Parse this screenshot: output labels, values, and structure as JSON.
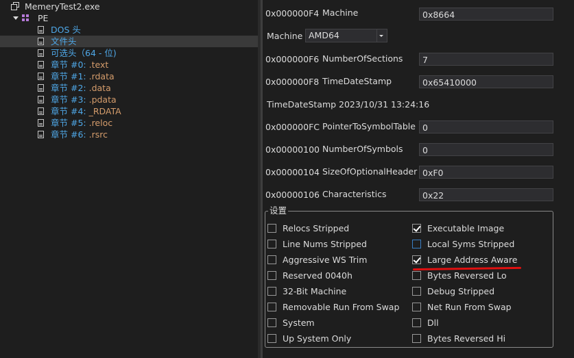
{
  "tree": {
    "root": "MemeryTest2.exe",
    "pe": "PE",
    "items": [
      {
        "label": "DOS 头",
        "color": "blue",
        "selected": false
      },
      {
        "label": "文件头",
        "color": "blue",
        "selected": true
      },
      {
        "label": "可选头（64 - 位)",
        "color": "blue",
        "selected": false
      },
      {
        "prefix": "章节 #0: ",
        "name": ".text",
        "selected": false
      },
      {
        "prefix": "章节 #1: ",
        "name": ".rdata",
        "selected": false
      },
      {
        "prefix": "章节 #2: ",
        "name": ".data",
        "selected": false
      },
      {
        "prefix": "章节 #3: ",
        "name": ".pdata",
        "selected": false
      },
      {
        "prefix": "章节 #4: ",
        "name": "_RDATA",
        "selected": false
      },
      {
        "prefix": "章节 #5: ",
        "name": ".reloc",
        "selected": false
      },
      {
        "prefix": "章节 #6: ",
        "name": ".rsrc",
        "selected": false
      }
    ]
  },
  "header": {
    "machine": {
      "offset": "0x000000F4",
      "name": "Machine",
      "value": "0x8664"
    },
    "machine_combo": {
      "label": "Machine",
      "value": "AMD64"
    },
    "sections": {
      "offset": "0x000000F6",
      "name": "NumberOfSections",
      "value": "7"
    },
    "timestamp": {
      "offset": "0x000000F8",
      "name": "TimeDateStamp",
      "value": "0x65410000"
    },
    "timestamp_text": {
      "label": "TimeDateStamp",
      "value": "2023/10/31 13:24:16"
    },
    "symtable": {
      "offset": "0x000000FC",
      "name": "PointerToSymbolTable",
      "value": "0"
    },
    "numsyms": {
      "offset": "0x00000100",
      "name": "NumberOfSymbols",
      "value": "0"
    },
    "optsize": {
      "offset": "0x00000104",
      "name": "SizeOfOptionalHeader",
      "value": "0xF0"
    },
    "chars": {
      "offset": "0x00000106",
      "name": "Characteristics",
      "value": "0x22"
    }
  },
  "settings": {
    "title": "设置",
    "left": [
      {
        "label": "Relocs Stripped",
        "checked": false
      },
      {
        "label": "Line Nums Stripped",
        "checked": false
      },
      {
        "label": "Aggressive WS Trim",
        "checked": false
      },
      {
        "label": "Reserved 0040h",
        "checked": false
      },
      {
        "label": "32-Bit Machine",
        "checked": false
      },
      {
        "label": "Removable Run From Swap",
        "checked": false
      },
      {
        "label": "System",
        "checked": false
      },
      {
        "label": "Up System Only",
        "checked": false
      }
    ],
    "right": [
      {
        "label": "Executable Image",
        "checked": true
      },
      {
        "label": "Local Syms Stripped",
        "checked": false,
        "focused": true
      },
      {
        "label": "Large Address Aware",
        "checked": true
      },
      {
        "label": "Bytes Reversed Lo",
        "checked": false
      },
      {
        "label": "Debug Stripped",
        "checked": false
      },
      {
        "label": "Net Run From Swap",
        "checked": false
      },
      {
        "label": "Dll",
        "checked": false
      },
      {
        "label": "Bytes Reversed Hi",
        "checked": false
      }
    ]
  },
  "colors": {
    "background": "#1e1e1e",
    "accent_blue": "#4fa8e8",
    "section_orange": "#d69d6c",
    "annotation_red": "#e01010"
  }
}
